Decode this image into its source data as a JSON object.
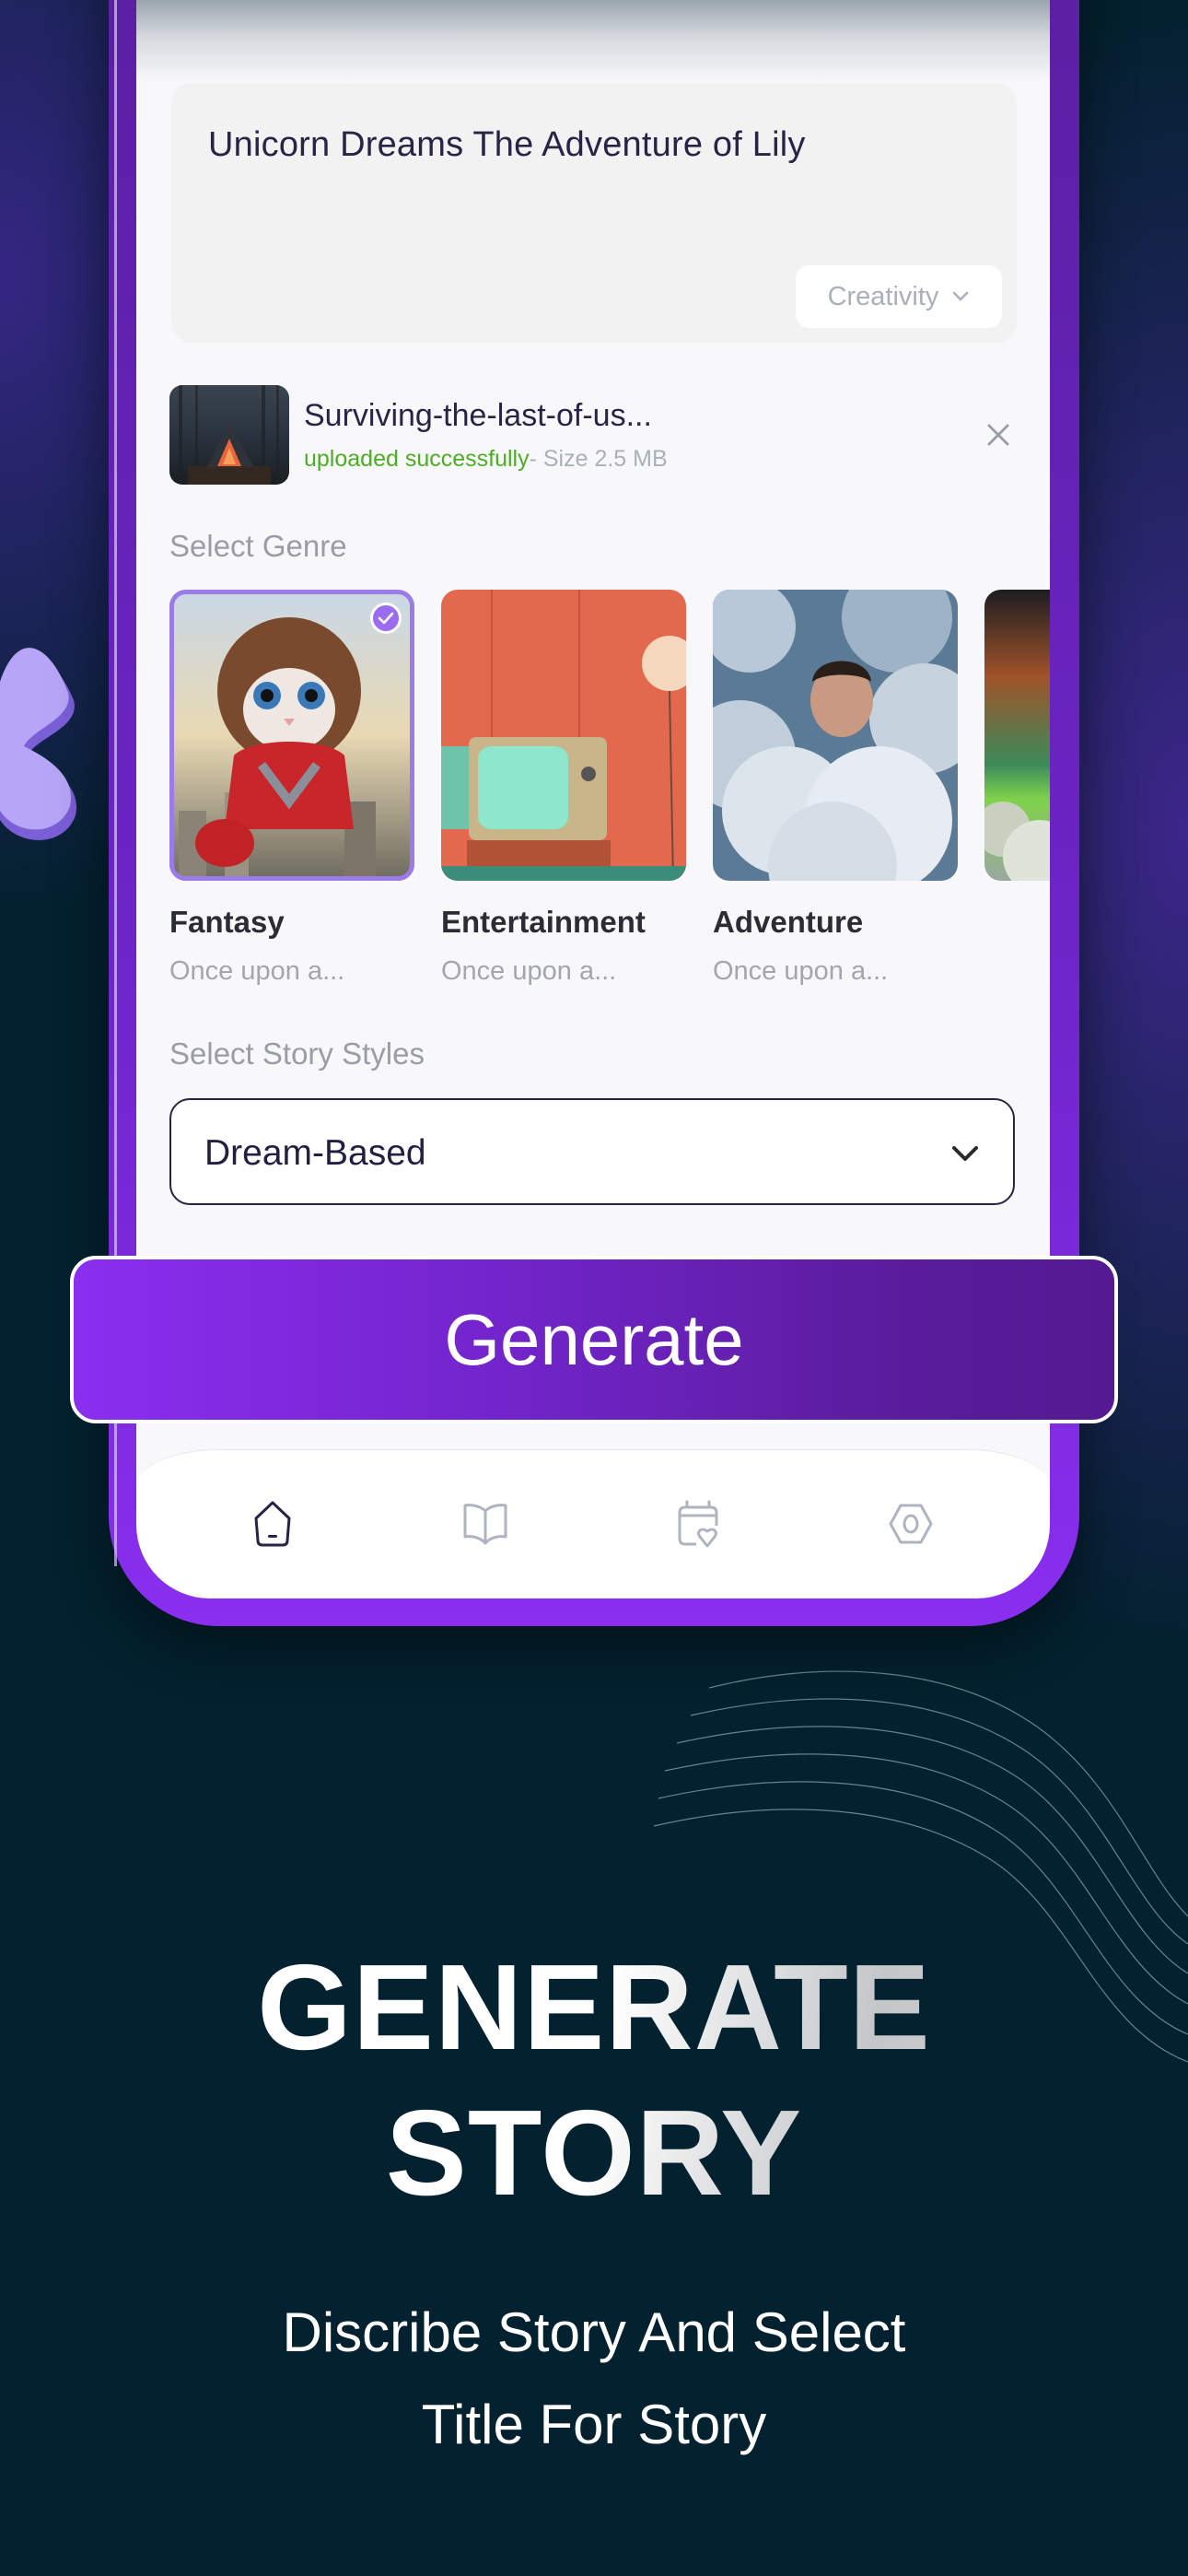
{
  "prompt": {
    "text": "Unicorn Dreams The Adventure of Lily",
    "creativity_label": "Creativity"
  },
  "upload": {
    "file_name": "Surviving-the-last-of-us...",
    "status_text": "uploaded successfully",
    "size_text": "- Size 2.5 MB"
  },
  "genre": {
    "label": "Select Genre",
    "items": [
      {
        "title": "Fantasy",
        "desc": "Once upon a...",
        "selected": true
      },
      {
        "title": "Entertainment",
        "desc": "Once upon a...",
        "selected": false
      },
      {
        "title": "Adventure",
        "desc": "Once upon a...",
        "selected": false
      },
      {
        "title": "",
        "desc": "",
        "selected": false
      }
    ]
  },
  "story_style": {
    "label": "Select Story Styles",
    "value": "Dream-Based"
  },
  "generate_button": {
    "label": "Generate"
  },
  "bottom_nav": {
    "items": [
      {
        "icon": "home-icon",
        "active": true
      },
      {
        "icon": "book-icon",
        "active": false
      },
      {
        "icon": "calendar-heart-icon",
        "active": false
      },
      {
        "icon": "settings-icon",
        "active": false
      }
    ]
  },
  "promo": {
    "headline_line1": "GENERATE",
    "headline_line2": "STORY",
    "subtitle_line1": "Discribe Story And Select",
    "subtitle_line2": "Title For Story"
  },
  "colors": {
    "accent": "#8b2ef0",
    "background": "#03212e",
    "success": "#4cae22",
    "text_dark": "#2a2346"
  }
}
